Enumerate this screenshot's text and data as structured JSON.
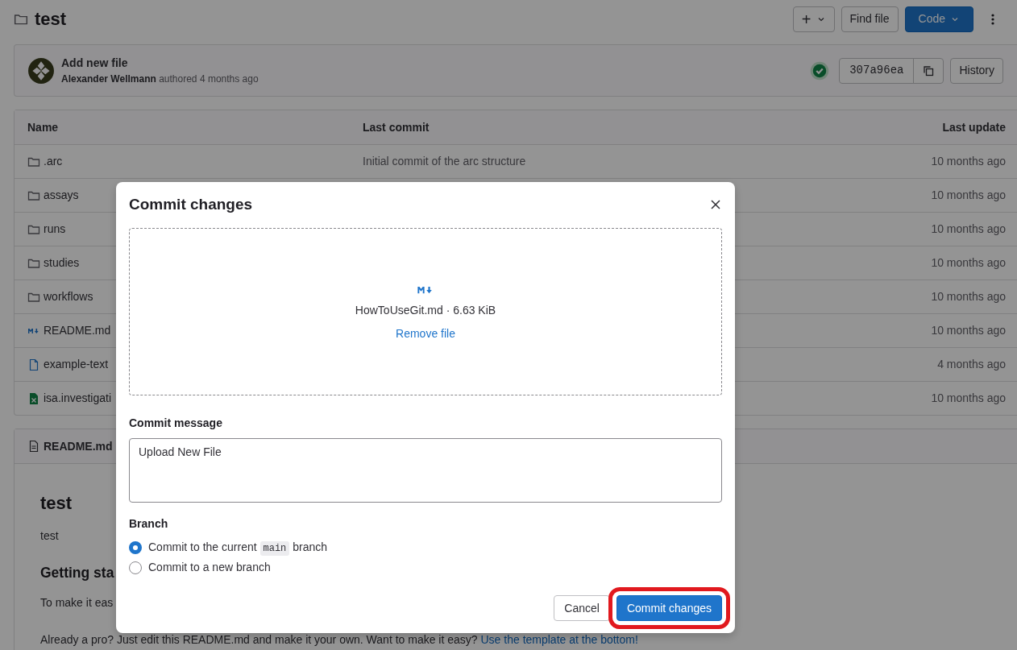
{
  "project": {
    "title": "test"
  },
  "header_buttons": [
    {
      "kind": "split",
      "label": "+"
    },
    {
      "kind": "default",
      "label": "Find file"
    },
    {
      "kind": "primary",
      "label": "Code"
    },
    {
      "kind": "kebab"
    }
  ],
  "last_commit": {
    "title": "Add new file",
    "author": "Alexander Wellmann",
    "meta": "authored 4 months ago",
    "pipeline_passed": true,
    "sha": "307a96ea",
    "history_button": "History"
  },
  "file_table": {
    "columns": [
      "Name",
      "Last commit",
      "Last update"
    ],
    "rows": [
      {
        "kind": "folder",
        "name": ".arc",
        "last_commit": "Initial commit of the arc structure",
        "last_update": "10 months ago"
      },
      {
        "kind": "folder",
        "name": "assays",
        "last_update": "10 months ago"
      },
      {
        "kind": "folder",
        "name": "runs",
        "last_update": "10 months ago"
      },
      {
        "kind": "folder",
        "name": "studies",
        "last_update": "10 months ago"
      },
      {
        "kind": "folder",
        "name": "workflows",
        "last_update": "10 months ago"
      },
      {
        "kind": "markdown",
        "name": "README.md",
        "last_update": "10 months ago"
      },
      {
        "kind": "text",
        "name": "example-text",
        "last_update": "4 months ago"
      },
      {
        "kind": "spreadsheet",
        "name": "isa.investigati",
        "last_update": "10 months ago"
      }
    ]
  },
  "readme": {
    "filename": "README.md",
    "blocks": [
      {
        "kind": "h1",
        "text": "test"
      },
      {
        "kind": "p",
        "text": "test"
      },
      {
        "kind": "h2",
        "text": "Getting sta"
      },
      {
        "kind": "p",
        "text": "To make it eas"
      },
      {
        "kind": "p",
        "text": "Already a pro? Just edit this README.md and make it your own. Want to make it easy? ",
        "link": "Use the template at the bottom!"
      }
    ]
  },
  "modal": {
    "title": "Commit changes",
    "file_line": "HowToUseGit.md · 6.63 KiB",
    "remove_link": "Remove file",
    "message_label": "Commit message",
    "message": "Upload New File",
    "branch_label": "Branch",
    "branch_options": [
      {
        "text_before": "Commit to the current ",
        "code": "main",
        "text_after": " branch",
        "selected": true
      },
      {
        "text_before": "Commit to a new branch",
        "selected": false
      }
    ],
    "buttons": [
      {
        "kind": "cancel",
        "label": "Cancel",
        "highlighted": false
      },
      {
        "kind": "primary",
        "label": "Commit changes",
        "highlighted": true
      }
    ]
  }
}
